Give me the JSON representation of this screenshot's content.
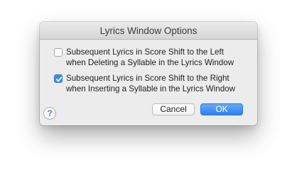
{
  "dialog": {
    "title": "Lyrics Window Options",
    "options": [
      {
        "checked": false,
        "line1": "Subsequent Lyrics in Score Shift to the Left",
        "line2": "when Deleting a Syllable in the Lyrics Window"
      },
      {
        "checked": true,
        "line1": "Subsequent Lyrics in Score Shift to the Right",
        "line2": "when Inserting a Syllable in the Lyrics Window"
      }
    ],
    "help_glyph": "?",
    "cancel_label": "Cancel",
    "ok_label": "OK"
  },
  "colors": {
    "accent": "#2d82ef",
    "dialog_bg": "#ececec"
  },
  "icons": {
    "help": "question-mark-icon",
    "check": "checkmark-icon"
  }
}
